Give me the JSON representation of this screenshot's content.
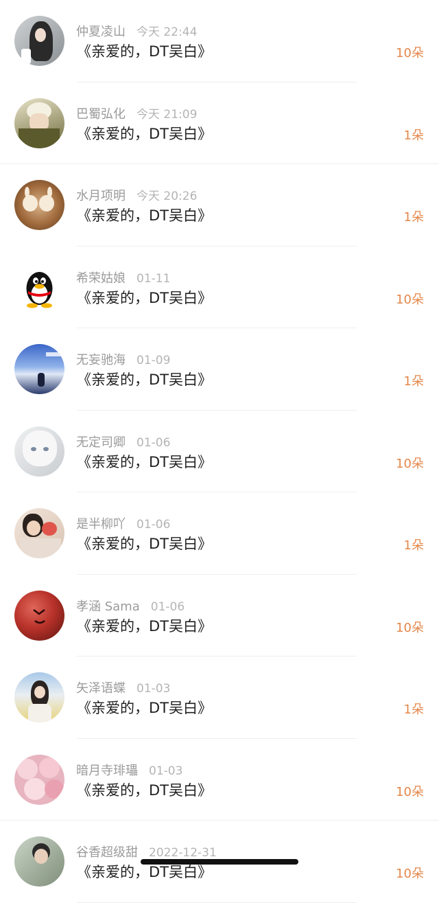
{
  "items": [
    {
      "name": "仲夏凌山",
      "time": "今天 22:44",
      "title": "《亲爱的，DT吴白》",
      "count": "10朵",
      "avatar": "photo-girl-grey"
    },
    {
      "name": "巴蜀弘化",
      "time": "今天 21:09",
      "title": "《亲爱的，DT吴白》",
      "count": "1朵",
      "avatar": "anime-olive"
    },
    {
      "name": "水月项明",
      "time": "今天 20:26",
      "title": "《亲爱的，DT吴白》",
      "count": "1朵",
      "avatar": "latte-art"
    },
    {
      "name": "希荣姑娘",
      "time": "01-11",
      "title": "《亲爱的，DT吴白》",
      "count": "10朵",
      "avatar": "qq-penguin"
    },
    {
      "name": "无妄驰海",
      "time": "01-09",
      "title": "《亲爱的，DT吴白》",
      "count": "1朵",
      "avatar": "blue-sky-scene"
    },
    {
      "name": "无定司卿",
      "time": "01-06",
      "title": "《亲爱的，DT吴白》",
      "count": "10朵",
      "avatar": "anime-white-hair"
    },
    {
      "name": "是半柳吖",
      "time": "01-06",
      "title": "《亲爱的，DT吴白》",
      "count": "1朵",
      "avatar": "photo-child"
    },
    {
      "name": "孝涵 Sama",
      "time": "01-06",
      "title": "《亲爱的，DT吴白》",
      "count": "10朵",
      "avatar": "red-ball"
    },
    {
      "name": "矢泽语蝶",
      "time": "01-03",
      "title": "《亲爱的，DT吴白》",
      "count": "1朵",
      "avatar": "photo-girl-yellow"
    },
    {
      "name": "暗月寺琲瓃",
      "time": "01-03",
      "title": "《亲爱的，DT吴白》",
      "count": "10朵",
      "avatar": "strawberries"
    },
    {
      "name": "谷香超级甜",
      "time": "2022-12-31",
      "title": "《亲爱的，DT吴白》",
      "count": "10朵",
      "avatar": "photo-man"
    }
  ],
  "accent_color": "#e5874a"
}
